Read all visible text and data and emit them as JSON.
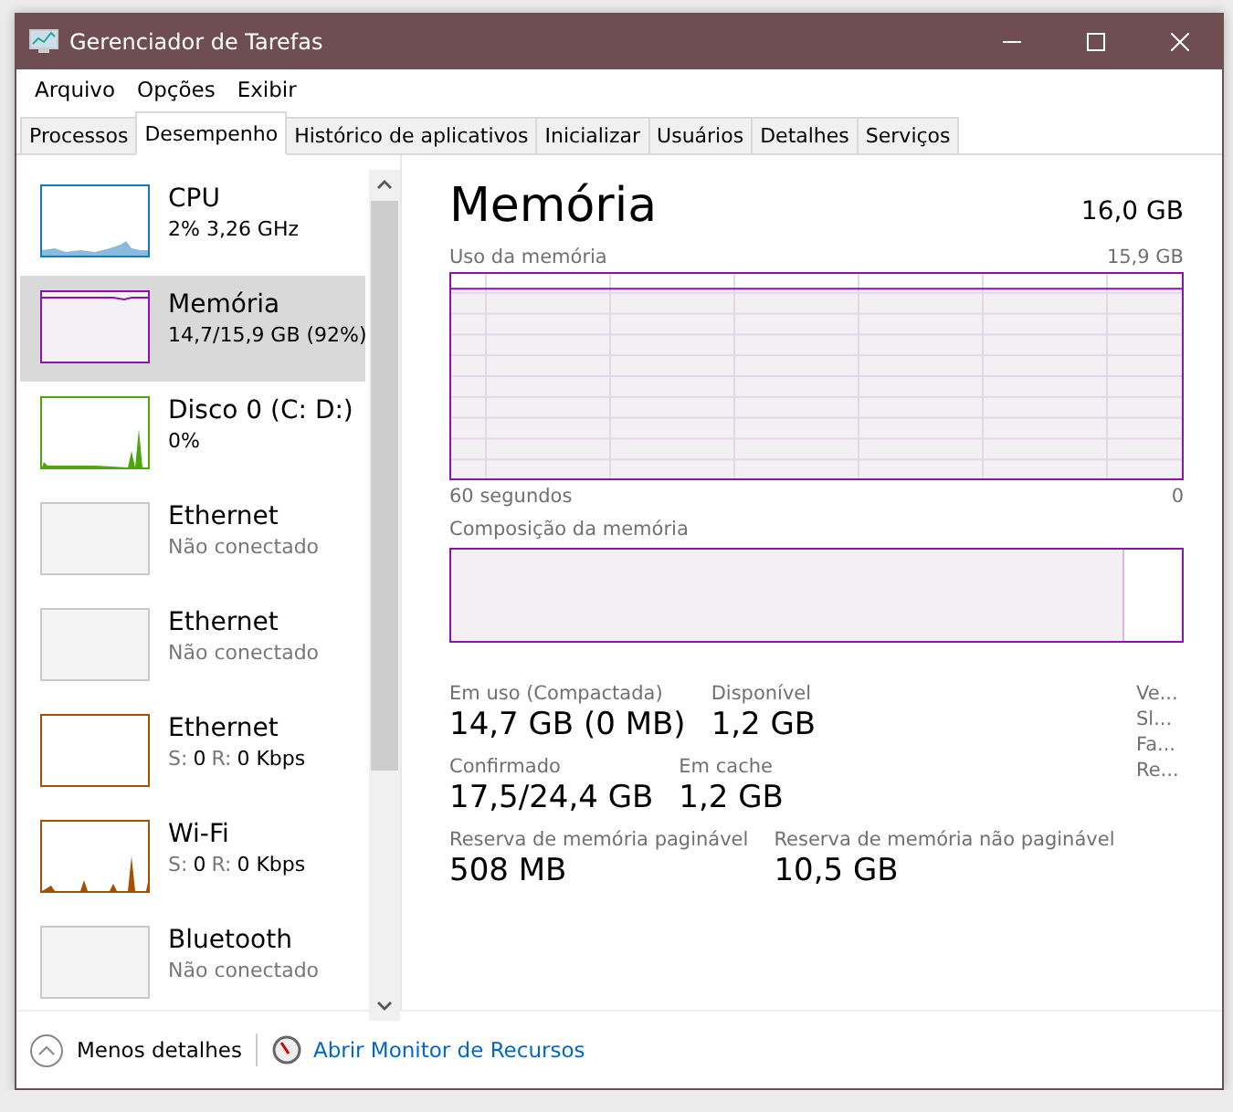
{
  "window": {
    "title": "Gerenciador de Tarefas"
  },
  "menu": [
    "Arquivo",
    "Opções",
    "Exibir"
  ],
  "tabs": [
    {
      "label": "Processos",
      "selected": false
    },
    {
      "label": "Desempenho",
      "selected": true
    },
    {
      "label": "Histórico de aplicativos",
      "selected": false
    },
    {
      "label": "Inicializar",
      "selected": false
    },
    {
      "label": "Usuários",
      "selected": false
    },
    {
      "label": "Detalhes",
      "selected": false
    },
    {
      "label": "Serviços",
      "selected": false
    }
  ],
  "sidebar": {
    "items": [
      {
        "kind": "cpu",
        "title": "CPU",
        "subtitle": "2% 3,26 GHz",
        "color": "#1478bd",
        "selected": false
      },
      {
        "kind": "memory",
        "title": "Memória",
        "subtitle": "14,7/15,9 GB (92%)",
        "color": "#8b12ae",
        "selected": true
      },
      {
        "kind": "disk",
        "title": "Disco 0 (C: D:)",
        "subtitle": "0%",
        "color": "#4da60c",
        "selected": false
      },
      {
        "kind": "offline",
        "title": "Ethernet",
        "subtitle": "Não conectado",
        "color": "#c8c8c8",
        "selected": false
      },
      {
        "kind": "offline",
        "title": "Ethernet",
        "subtitle": "Não conectado",
        "color": "#c8c8c8",
        "selected": false
      },
      {
        "kind": "network",
        "title": "Ethernet",
        "sent_label": "S:",
        "sent": "0",
        "recv_label": "R:",
        "recv": "0 Kbps",
        "color": "#a74f01",
        "selected": false
      },
      {
        "kind": "wifi",
        "title": "Wi-Fi",
        "sent_label": "S:",
        "sent": "0",
        "recv_label": "R:",
        "recv": "0 Kbps",
        "color": "#a74f01",
        "selected": false
      },
      {
        "kind": "offline",
        "title": "Bluetooth",
        "subtitle": "Não conectado",
        "color": "#c8c8c8",
        "selected": false
      }
    ]
  },
  "detail": {
    "title": "Memória",
    "total": "16,0 GB",
    "usage_label": "Uso da memória",
    "usage_max": "15,9 GB",
    "time_label": "60 segundos",
    "time_end": "0",
    "composition_label": "Composição da memória",
    "composition_bar": {
      "level": 0.92
    },
    "stats": [
      [
        {
          "label": "Em uso (Compactada)",
          "value": "14,7 GB (0 MB)"
        },
        {
          "label": "Disponível",
          "value": "1,2 GB"
        }
      ],
      [
        {
          "label": "Confirmado",
          "value": "17,5/24,4 GB"
        },
        {
          "label": "Em cache",
          "value": "1,2 GB"
        }
      ],
      [
        {
          "label": "Reserva de memória paginável",
          "value": "508 MB"
        },
        {
          "label": "Reserva de memória não paginável",
          "value": "10,5 GB"
        }
      ]
    ],
    "side_stats": [
      "Ve...",
      "Sl...",
      "Fa...",
      "Re..."
    ]
  },
  "footer": {
    "fewer_details": "Menos detalhes",
    "resource_monitor": "Abrir Monitor de Recursos"
  }
}
